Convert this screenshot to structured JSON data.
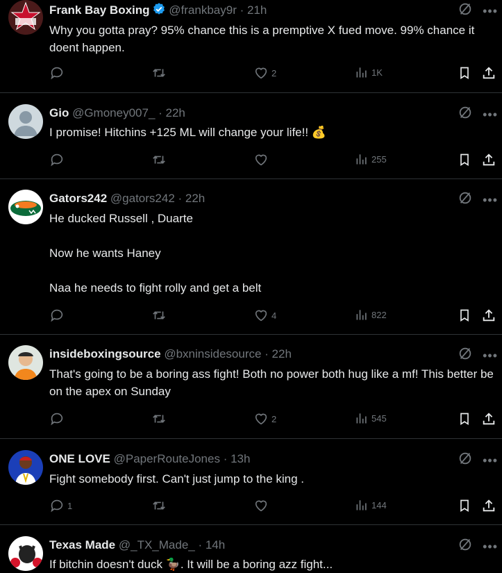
{
  "tweets": [
    {
      "name": "Frank Bay Boxing",
      "verified": true,
      "handle": "@frankbay9r",
      "time": "· 21h",
      "text": "Why you gotta pray? 95% chance this is a premptive X fued move. 99% chance it doent happen.",
      "replies": "",
      "likes": "2",
      "views": "1K"
    },
    {
      "name": "Gio",
      "verified": false,
      "handle": "@Gmoney007_",
      "time": "· 22h",
      "text": "I promise! Hitchins +125 ML will change your life!! 💰",
      "replies": "",
      "likes": "",
      "views": "255"
    },
    {
      "name": "Gators242",
      "verified": false,
      "handle": "@gators242",
      "time": "· 22h",
      "text": "He ducked Russell , Duarte\n\nNow he wants Haney\n\nNaa he needs to fight rolly and get a belt",
      "replies": "",
      "likes": "4",
      "views": "822"
    },
    {
      "name": "insideboxingsource",
      "verified": false,
      "handle": "@bxninsidesource",
      "time": "· 22h",
      "text": "That's going to be a boring ass fight! Both no power both hug like a mf! This better be on the apex on Sunday",
      "replies": "",
      "likes": "2",
      "views": "545"
    },
    {
      "name": "ONE LOVE",
      "verified": false,
      "handle": "@PaperRouteJones",
      "time": "· 13h",
      "text": "Fight somebody first. Can't just jump to the king .",
      "replies": "1",
      "likes": "",
      "views": "144"
    },
    {
      "name": "Texas Made",
      "verified": false,
      "handle": "@_TX_Made_",
      "time": "· 14h",
      "text": "If bitchin doesn't duck 🦆. It will be a boring azz fight...",
      "replies": "",
      "likes": "",
      "views": ""
    }
  ],
  "colors": {
    "background": "#000000",
    "text": "#e7e9ea",
    "muted": "#71767b",
    "divider": "#2f3336",
    "verified": "#1d9bf0"
  },
  "icons": {
    "reply": "reply-icon",
    "retweet": "retweet-icon",
    "like": "heart-icon",
    "views": "views-icon",
    "bookmark": "bookmark-icon",
    "share": "share-icon",
    "grok": "grok-icon",
    "more": "more-icon"
  }
}
